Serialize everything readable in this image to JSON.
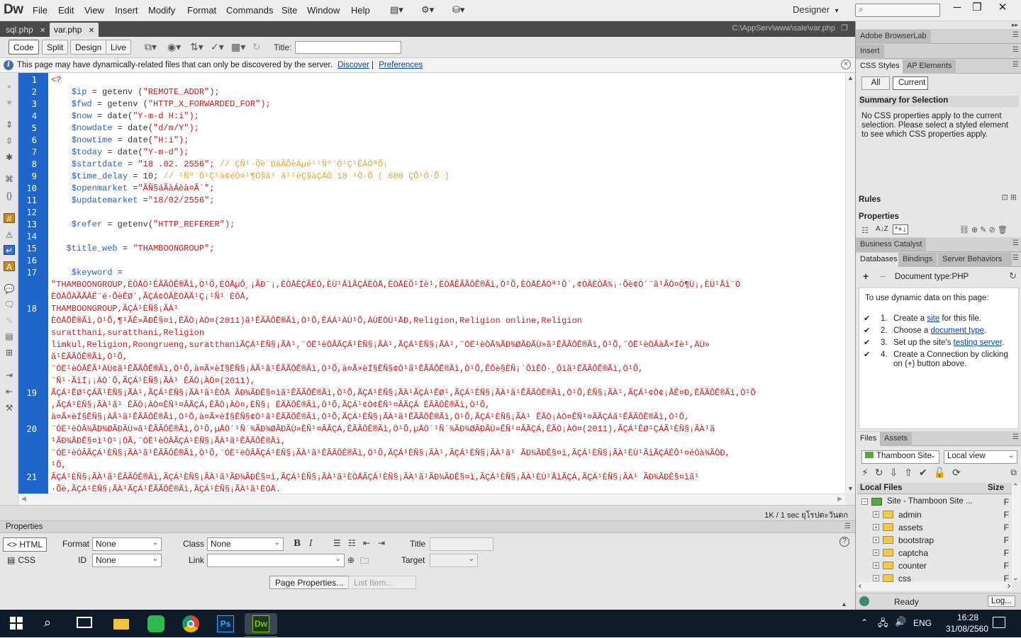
{
  "app": {
    "logo": "Dw",
    "menu": [
      "File",
      "Edit",
      "View",
      "Insert",
      "Modify",
      "Format",
      "Commands",
      "Site",
      "Window",
      "Help"
    ],
    "workspace": "Designer",
    "workspace_arrow": "▾",
    "win_min": "─",
    "win_max": "❐",
    "win_close": "✕"
  },
  "doc_tabs": [
    {
      "label": "sql.php",
      "close": "✕"
    },
    {
      "label": "var.php",
      "close": "✕"
    }
  ],
  "doc_path": "C:\\AppServ\\www\\sale\\var.php",
  "toolbar": {
    "views": [
      "Code",
      "Split",
      "Design",
      "Live"
    ],
    "title_label": "Title:",
    "title_value": ""
  },
  "infobar": {
    "text": "This page may have dynamically-related files that can only be discovered by the server.",
    "discover": "Discover",
    "preferences": "Preferences"
  },
  "line_numbers": [
    "1",
    "2",
    "3",
    "4",
    "5",
    "6",
    "7",
    "8",
    "9",
    "10",
    "11",
    "12",
    "13",
    "14",
    "15",
    "16",
    "17",
    "18",
    "19",
    "20",
    "21"
  ],
  "code_lines": [
    {
      "indent": "",
      "var": "",
      "fn": "",
      "str": "<?",
      "cm": ""
    },
    {
      "indent": "    ",
      "var": "$ip",
      "fn": " = getenv (",
      "str": "\"REMOTE_ADDR\");",
      "cm": ""
    },
    {
      "indent": "    ",
      "var": "$fwd",
      "fn": " = getenv (",
      "str": "\"HTTP_X_FORWARDED_FOR\");",
      "cm": ""
    },
    {
      "indent": "    ",
      "var": "$now",
      "fn": " = date(",
      "str": "\"Y-m-d H:i\");",
      "cm": ""
    },
    {
      "indent": "    ",
      "var": "$nowdate",
      "fn": " = date(",
      "str": "\"d/m/Y\");",
      "cm": ""
    },
    {
      "indent": "    ",
      "var": "$nowtime",
      "fn": " = date(",
      "str": "\"H:i\");",
      "cm": ""
    },
    {
      "indent": "    ",
      "var": "$today",
      "fn": " = date(",
      "str": "\"Y-m-d\");",
      "cm": ""
    },
    {
      "indent": "    ",
      "var": "$startdate",
      "fn": " = ",
      "str": "\"18 .02. 2556\";",
      "cm": " // ÇÑ¹·Õè¨ÐàÃÔèÁµé¹¹Ñº¨Ó¹Ç¹ÊÁÒªÔ¡"
    },
    {
      "indent": "    ",
      "var": "$time_delay",
      "fn": " = 10;",
      "str": "",
      "cm": " // ¹Ñº¨Ó¹Ç¹à¢éÒ¤¹¶Ö§ã¹ ã¹¹èÇ§àÇÅÒ 10 ¹Ò·Õ ( 600 ÇÔ¹Ò·Õ )"
    },
    {
      "indent": "    ",
      "var": "$openmarket",
      "fn": " =",
      "str": "\"ÃÑ§áÃàÁèà¤Ã´\";",
      "cm": ""
    },
    {
      "indent": "    ",
      "var": "$updatemarket",
      "fn": " =",
      "str": "\"18/02/2556\";",
      "cm": ""
    },
    {
      "indent": "",
      "var": "",
      "fn": "",
      "str": "",
      "cm": ""
    },
    {
      "indent": "    ",
      "var": "$refer",
      "fn": " = getenv(",
      "str": "\"HTTP_REFERER\");",
      "cm": ""
    },
    {
      "indent": "",
      "var": "",
      "fn": "",
      "str": "",
      "cm": ""
    },
    {
      "indent": "   ",
      "var": "$title_web",
      "fn": " = ",
      "str": "\"THAMBOONGROUP\";",
      "cm": ""
    },
    {
      "indent": "",
      "var": "",
      "fn": "",
      "str": "",
      "cm": ""
    },
    {
      "indent": "    ",
      "var": "$keyword",
      "fn": " =",
      "str": "",
      "cm": ""
    }
  ],
  "wrapped_text": [
    "\"THAMBOONGROUP,ÈÒÅÒ¹ÊÃÃÔÊ®Ãì,Ò¹Õ,ÈÒÅµÔ¸¡ÃÐ¨¡,ÈÒÅÊÇÃÉÒ,ÈÙ¹ÂìÃÇÁÈÒÅ,ÈÒÅÈÕ¹Íè¹,ÈÒÅÊÃÃÔÊ®Ãì,Ò¹Õ,ÈÒÅÉÅÒª¹Ô´,¢ÒÂÈÒÅ¾¡·Õè¢Ò´¨ã¹ÃÒ¤Ò¶Ù¡,ÈÙ¹Âì¨Ó",
    "ÈÒÅÕÀÃÃÂË¨é·ÕèÊØ´,ÃÇÁ¢ÒÂÈÒÅÃ¹Ç¡¹Ñ¹ ÈÒÅ,",
    "THAMBOONGROUP,ÃÇÁ¹ÈÑ§¡ÃÀ¹",
    "ÈÒÅÕÊ®Ãì,Ò¹Õ,¶¹ÃÊ»ÃÐÊ§¤ì,ÊÃÒ¡ÀÒ¤(2011)ã¹ÊÃÃÔÊ®Ãì,Ò¹Õ,ÊÁÁ¹ÀÙ¹Õ,ÁÙËÒÙ¹ÅÐ,Religion,Religion online,Religion",
    "suratthani,suratthani,Religion",
    "limkul,Religion,Roongrueng,suratthaniÃÇÁ¹ÈÑ§¡ÃÀ¹,¨ÓË¹èÒÂÃÇÁ¹ÈÑ§¡ÃÀ¹,ÃÇÁ¹ÈÑ§¡ÃÀ¹,¨ÓË¹èÒÂ¾ÃÐ¾ØÃÐÃÙ»ã¹ÊÃÃÔÊ®Ãì,Ò¹Õ,¨ÓË¹èÒÂàÃ×Íè¹,ÄÙ»",
    "ã¹ÊÃÃÔÊ®Ãì,Ò¹Õ,",
    "¨ÓË¹èÒÂÊÃ¹ÀÙ¢ã¹ÊÃÃÔÊ®Ãì,Ò¹Õ,à¤Ã×èÍ§ÊÑ§¡ÀÃ¹ã¹ÊÃÃÔÊ®Ãì,Ò¹Õ,à¤Ã×èÍ§ÊÑ§¢Ò¹ã¹ÊÃÃÔÊ®Ãì,Ò¹Õ,ÊÔè§ÈÑ¡´ÔìÊÔ·¸Ôìã¹ÊÃÃÔÊ®Ãì,Ò¹Õ,",
    "¨Ñ¹·ÃìÍ¡¡ÀÒ´Õ,ÃÇÁ¹ÈÑ§¡ÃÀ¹ ÊÃÒ¡ÀÒ¤(2011),",
    "ÃÇÁ¹ÊØ¹ÇÁÃ¹ÈÑ§¡ÃÀ¹,ÃÇÁ¹ÈÑ§¡ÃÀ¹ã¹ÈÒÅ ÃÐ¾ÃÐÊ§¤ìã¹ÊÃÃÔÊ®Ãì,Ò¹Õ,ÃÇÁ¹ÈÑ§¡ÃÀ¹ÃÇÁ¹ÊØ¹,ÃÇÁ¹ÈÑ§¡ÃÀ¹ã¹ÊÃÃÔÊ®Ãì,Ò¹Õ,ÈÑ§¡ÃÀ¹,ÃÇÁ¹¢Ò¢¡ÂÊ¤Ð,ÊÃÃÔÊ®Ãì,Ò¹Õ",
    ",ÃÇÁ¹ÈÑ§¡ÃÀ¹ã¹ ÊÃÒ¡ÀÒ¤ÊÑ¹¤ÂÃÇÁ,ÊÃÒ¡ÀÒ¤,ÈÑ§¡ ÊÃÃÔÊ®Ãì,Ò¹Õ,ÃÇÁ¹¢Ò¢ÊÑ¹¤ÂÃÇÁ ÊÃÃÔÊ®Ãì,Ò¹Õ,",
    "à¤Ã×èÍ§ÊÑ§¡ÀÃ¹ã¹ÊÃÃÔÊ®Ãì,Ò¹Õ,à¤Ã×èÍ§ÊÑ§¢Ò¹ã¹ÊÃÃÔÊ®Ãì,Ò¹Õ,ÃÇÁ¹ÈÑ§¡ÃÀ¹ã¹ÊÃÃÔÊ®Ãì,Ò¹Õ,ÃÇÁ¹ÈÑ§¡ÃÀ¹ ÊÃÒ¡ÀÒ¤ÊÑ¹¤ÂÃÇÁã¹ÊÃÃÔÊ®Ãì,Ò¹Õ,",
    "¨ÓË¹èÒÂ¾ÃÐ¾ØÃÐÃÙ»ã¹ÊÃÃÔÊ®Ãì,Ò¹Õ,µÅÒ´¹Ñ´¾ÃÐ¾ØÃÐÃÙ»ÊÑ¹¤ÂÃÇÁ,ÊÃÃÔÊ®Ãì,Ò¹Õ,µÅÒ´¹Ñ´¾ÃÐ¾ØÃÐÃÙ»ÊÑ¹¤ÂÃÇÁ,ÊÃÒ¡ÀÒ¤(2011),ÃÇÁ¹ÊØ¹ÇÁÃ¹ÈÑ§¡ÃÀ¹ã",
    "¹ÃÐ¾ÃÐÊ§¤ì¹Ò¹¡ÒÃ,¨ÓË¹èÒÂÃÇÁ¹ÈÑ§¡ÃÀ¹ã¹ÊÃÃÔÊ®Ãì,",
    "¨ÓË¹èÒÂÃÇÁ¹ÈÑ§¡ÃÀ¹ã¹ÊÃÃÔÊ®Ãì,Ò¹Õ,¨ÓË¹èÒÂÃÇÁ¹ÈÑ§¡ÃÀ¹ã¹ÊÃÃÔÊ®Ãì,Ò¹Õ,ÃÇÁ¹ÈÑ§¡ÃÀ¹,ÃÇÁ¹ÈÑ§¡ÃÀ¹ã¹ ÃÐ¾ÃÐÊ§¤ì,ÃÇÁ¹ÈÑ§¡ÃÀ¹ÈÙ¹ÂìÃÇÁÊÔ¹¤éÒà¾ÃÒÐ,",
    "¹Õ,",
    "ÃÇÁ¹ÈÑ§¡ÃÀ¹ã¹ÊÃÃÔÊ®Ãì,ÃÇÁ¹ÈÑ§¡ÃÀ¹ã¹ÃÐ¾ÃÐÊ§¤ì,ÃÇÁ¹ÈÑ§¡ÃÀ¹ã¹ÈÒÅÃÇÁ¹ÈÑ§¡ÃÀ¹ã¹ÃÐ¾ÃÐÊ§¤ì,ÃÇÁ¹ÈÑ§¡ÃÀ¹ÈÙ¹ÂìÃÇÁ,ÃÇÁ¹ÈÑ§¡ÃÀ¹ ÃÐ¾ÃÐÊ§¤ìã¹",
    "·Õè,ÃÇÁ¹ÈÑ§¡ÃÀ¹ÃÇÁ¹ÊÃÃÔÊ®Ãì,ÃÇÁ¹ÈÑ§¡ÃÀ¹ã¹ÈÒÅ."
  ],
  "status": {
    "text": "1K / 1 sec  ยุโรปตะวันตก"
  },
  "properties": {
    "title": "Properties",
    "html_btn": "<> HTML",
    "css_btn": "CSS",
    "format_label": "Format",
    "format_value": "None",
    "class_label": "Class",
    "class_value": "None",
    "id_label": "ID",
    "id_value": "None",
    "link_label": "Link",
    "link_value": "",
    "title_label": "Title",
    "target_label": "Target",
    "bold": "B",
    "italic": "I",
    "page_properties": "Page Properties...",
    "list_item": "List Item..."
  },
  "right_panels": {
    "browserlab": "Adobe BrowserLab",
    "insert": "Insert",
    "css_tabs": [
      "CSS Styles",
      "AP Elements"
    ],
    "css_modes": [
      "All",
      "Current"
    ],
    "summary_title": "Summary for Selection",
    "summary_text": "No CSS properties apply to the current selection.  Please select a styled element to see which CSS properties apply.",
    "rules": "Rules",
    "properties": "Properties",
    "az": "A↓Z",
    "business_catalyst": "Business Catalyst",
    "db_tabs": [
      "Databases",
      "Bindings",
      "Server Behaviors"
    ],
    "doc_type": "Document type:PHP",
    "dynamic_intro": "To use dynamic data on this page:",
    "steps": [
      {
        "num": "1.",
        "pre": "Create a ",
        "link": "site",
        "post": " for this file."
      },
      {
        "num": "2.",
        "pre": "Choose a ",
        "link": "document type",
        "post": "."
      },
      {
        "num": "3.",
        "pre": "Set up the site's ",
        "link": "testing server",
        "post": "."
      },
      {
        "num": "4.",
        "pre": "Create a Connection by clicking on (+) button above.",
        "link": "",
        "post": ""
      }
    ],
    "files_tabs": [
      "Files",
      "Assets"
    ],
    "site_select": "Thamboon Site",
    "view_select": "Local view",
    "local_files": "Local Files",
    "size": "Size",
    "site_root": "Site - Thamboon Site ...",
    "folders": [
      "admin",
      "assets",
      "bootstrap",
      "captcha",
      "counter",
      "css"
    ],
    "folder_flag": "F",
    "ready": "Ready",
    "log_btn": "Log..."
  },
  "taskbar": {
    "lang": "ENG",
    "time": "16:28",
    "date": "31/08/2560",
    "apps": [
      "Ps",
      "Dw"
    ]
  }
}
